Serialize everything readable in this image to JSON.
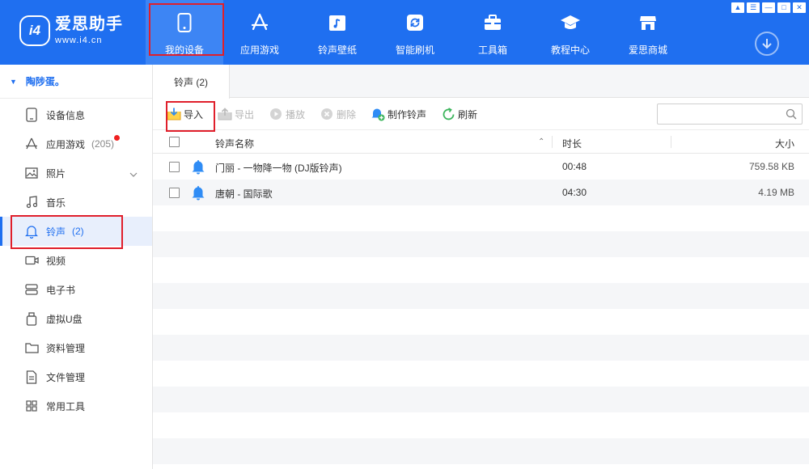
{
  "app": {
    "name": "爱思助手",
    "url": "www.i4.cn",
    "badge": "i4"
  },
  "colors": {
    "brand": "#1f6ff0",
    "highlight_box": "#e01f2b",
    "bell": "#2f8cf5",
    "sidebar_active_bg": "#e8effc"
  },
  "nav": [
    {
      "label": "我的设备",
      "icon": "phone-icon",
      "active": true
    },
    {
      "label": "应用游戏",
      "icon": "app-store-icon"
    },
    {
      "label": "铃声壁纸",
      "icon": "music-folder-icon"
    },
    {
      "label": "智能刷机",
      "icon": "refresh-box-icon"
    },
    {
      "label": "工具箱",
      "icon": "toolbox-icon"
    },
    {
      "label": "教程中心",
      "icon": "graduation-cap-icon"
    },
    {
      "label": "爱思商城",
      "icon": "store-icon"
    }
  ],
  "window_controls": [
    "shirt-icon",
    "menu-icon",
    "minimize-icon",
    "maximize-icon",
    "close-icon"
  ],
  "sidebar": {
    "device_name": "陶陟蛋。",
    "items": [
      {
        "label": "设备信息",
        "icon": "device-info-icon",
        "count": ""
      },
      {
        "label": "应用游戏",
        "icon": "app-store-icon",
        "count": "(205)"
      },
      {
        "label": "照片",
        "icon": "photo-icon",
        "count": ""
      },
      {
        "label": "音乐",
        "icon": "music-note-icon",
        "count": ""
      },
      {
        "label": "铃声",
        "icon": "bell-icon",
        "count": "(2)"
      },
      {
        "label": "视频",
        "icon": "video-icon",
        "count": ""
      },
      {
        "label": "电子书",
        "icon": "book-icon",
        "count": ""
      },
      {
        "label": "虚拟U盘",
        "icon": "usb-drive-icon",
        "count": ""
      },
      {
        "label": "资料管理",
        "icon": "folder-icon",
        "count": ""
      },
      {
        "label": "文件管理",
        "icon": "file-icon",
        "count": ""
      },
      {
        "label": "常用工具",
        "icon": "grid-tools-icon",
        "count": ""
      }
    ]
  },
  "main": {
    "tab_label": "铃声 (2)",
    "toolbar": {
      "import": "导入",
      "export": "导出",
      "play": "播放",
      "delete": "删除",
      "make_ringtone": "制作铃声",
      "refresh": "刷新"
    },
    "search": {
      "placeholder": "",
      "value": ""
    },
    "columns": {
      "name": "铃声名称",
      "duration": "时长",
      "size": "大小"
    },
    "rows": [
      {
        "name": "门丽 - 一物降一物 (DJ版铃声)",
        "duration": "00:48",
        "size": "759.58 KB"
      },
      {
        "name": "唐朝 - 国际歌",
        "duration": "04:30",
        "size": "4.19 MB"
      }
    ]
  }
}
